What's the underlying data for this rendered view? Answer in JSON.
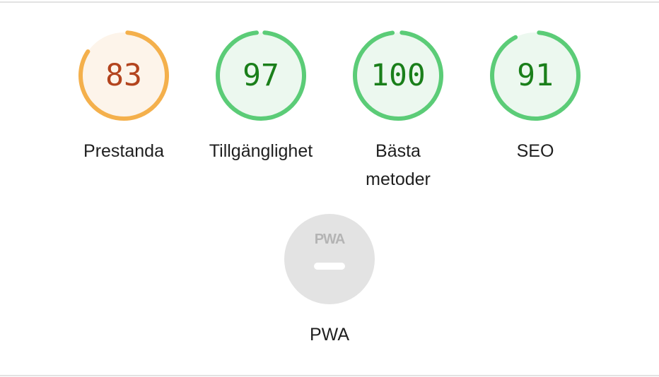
{
  "gauges": [
    {
      "id": "performance",
      "score": "83",
      "label": "Prestanda",
      "fraction": 0.83,
      "status": "average"
    },
    {
      "id": "accessibility",
      "score": "97",
      "label": "Tillgänglighet",
      "fraction": 0.97,
      "status": "pass"
    },
    {
      "id": "best-practices",
      "score": "100",
      "label": "Bästa metoder",
      "fraction": 1.0,
      "status": "pass"
    },
    {
      "id": "seo",
      "score": "91",
      "label": "SEO",
      "fraction": 0.91,
      "status": "pass"
    }
  ],
  "pwa": {
    "badge_text": "PWA",
    "label": "PWA",
    "icon": "pwa-badge-icon"
  },
  "colors": {
    "average_arc": "#f4b04c",
    "average_fill": "#fdf4ea",
    "average_text": "#b3441e",
    "pass_arc": "#5bcc77",
    "pass_fill": "#ecf8ef",
    "pass_text": "#1a7f1a",
    "pwa_badge": "#e3e3e3",
    "pwa_text": "#b4b4b4"
  }
}
